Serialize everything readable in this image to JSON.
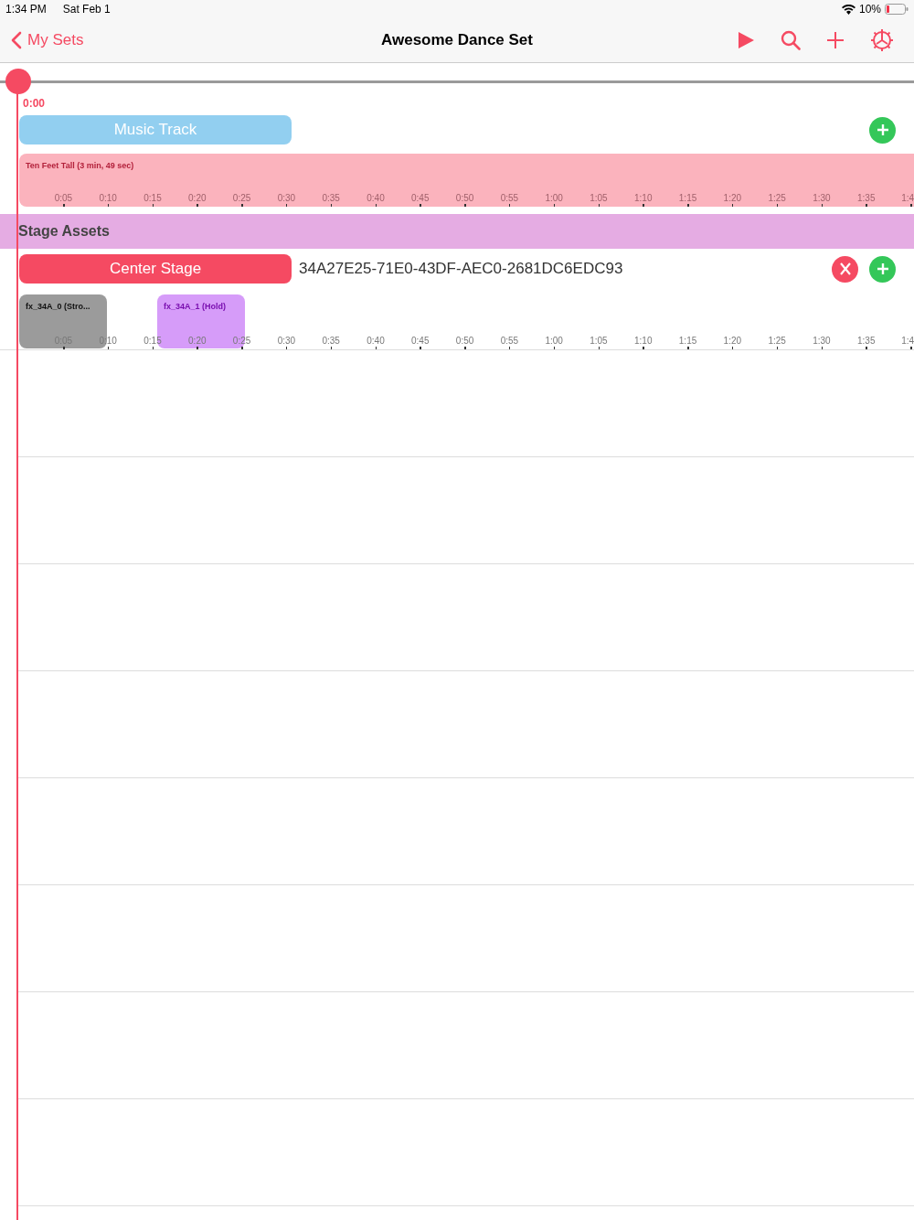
{
  "status_bar": {
    "time": "1:34 PM",
    "date": "Sat Feb 1",
    "battery": "10%"
  },
  "nav": {
    "back": "My Sets",
    "title": "Awesome Dance Set"
  },
  "playhead": {
    "time": "0:00"
  },
  "music": {
    "label": "Music Track",
    "song": "Ten Feet Tall (3 min, 49 sec)",
    "ticks": [
      "0:05",
      "0:10",
      "0:15",
      "0:20",
      "0:25",
      "0:30",
      "0:35",
      "0:40",
      "0:45",
      "0:50",
      "0:55",
      "1:00",
      "1:05",
      "1:10",
      "1:15",
      "1:20",
      "1:25",
      "1:30",
      "1:35",
      "1:4"
    ]
  },
  "section": {
    "title": "Stage Assets"
  },
  "assets": [
    {
      "label": "Center Stage",
      "id": "34A27E25-71E0-43DF-AEC0-2681DC6EDC93",
      "clips": [
        {
          "label": "fx_34A_0 (Stro...",
          "color": "#9b9b9b"
        },
        {
          "label": "fx_34A_1 (Hold)",
          "color": "#d69cf9"
        }
      ],
      "ticks": [
        "0:05",
        "0:10",
        "0:15",
        "0:20",
        "0:25",
        "0:30",
        "0:35",
        "0:40",
        "0:45",
        "0:50",
        "0:55",
        "1:00",
        "1:05",
        "1:10",
        "1:15",
        "1:20",
        "1:25",
        "1:30",
        "1:35",
        "1:4"
      ]
    }
  ]
}
